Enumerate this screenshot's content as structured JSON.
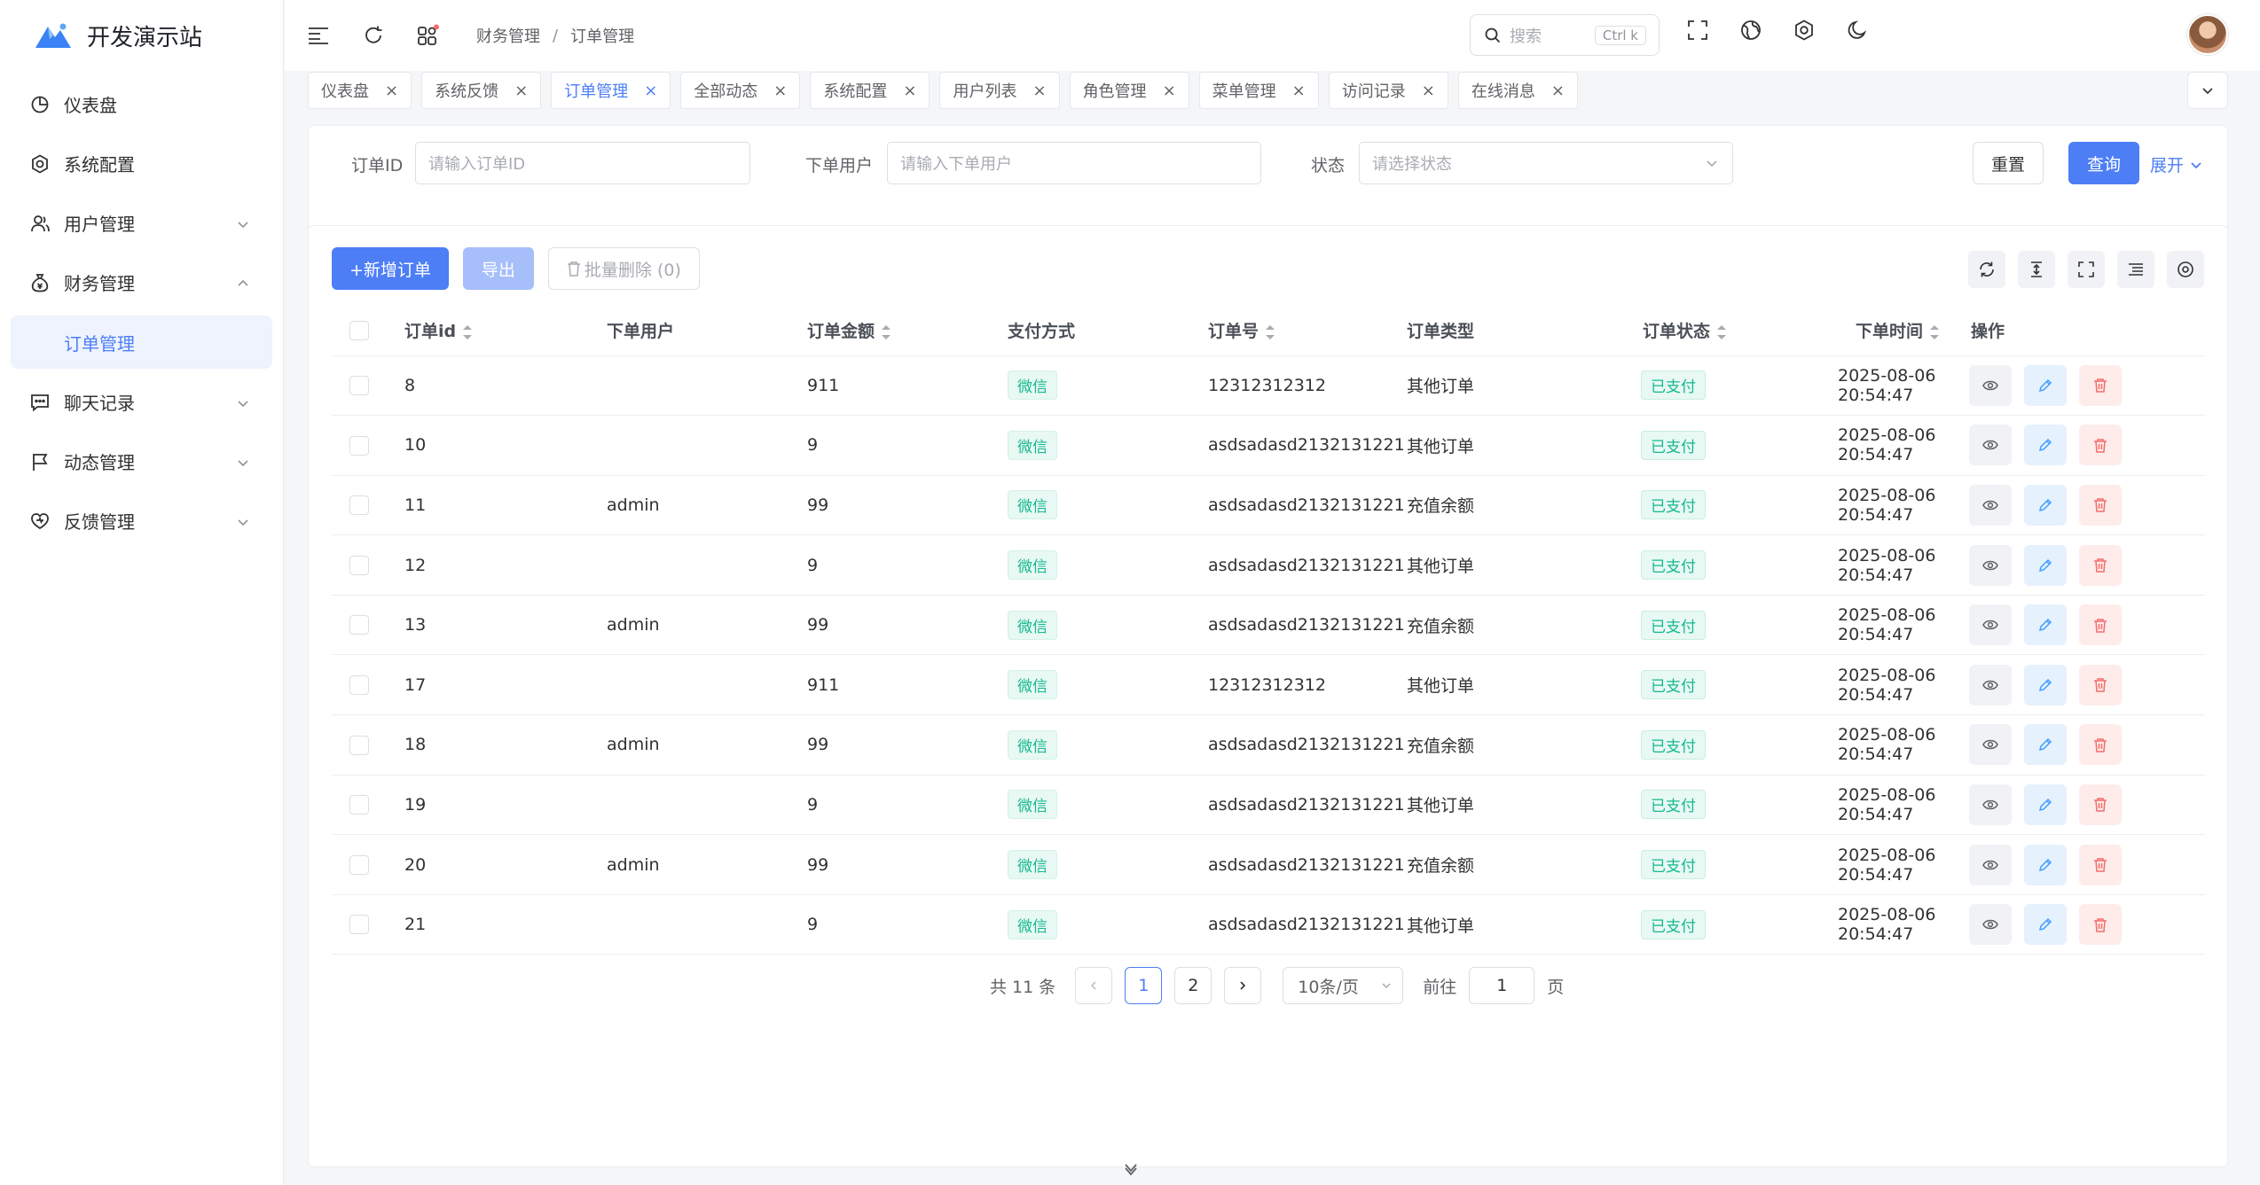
{
  "app": {
    "title": "开发演示站"
  },
  "sidebar": {
    "items": [
      {
        "label": "仪表盘",
        "icon": "dashboard-icon"
      },
      {
        "label": "系统配置",
        "icon": "gear-icon"
      },
      {
        "label": "用户管理",
        "icon": "users-icon"
      },
      {
        "label": "财务管理",
        "icon": "money-bag-icon",
        "expanded": true
      },
      {
        "label": "订单管理",
        "icon": "",
        "active": true
      },
      {
        "label": "聊天记录",
        "icon": "chat-icon"
      },
      {
        "label": "动态管理",
        "icon": "flag-icon"
      },
      {
        "label": "反馈管理",
        "icon": "heart-icon"
      }
    ]
  },
  "header": {
    "breadcrumb": [
      "财务管理",
      "订单管理"
    ],
    "breadcrumb_sep": "/",
    "search_placeholder": "搜索",
    "search_shortcut": "Ctrl k"
  },
  "tabs": [
    {
      "label": "仪表盘",
      "active": false
    },
    {
      "label": "系统反馈",
      "active": false
    },
    {
      "label": "订单管理",
      "active": true
    },
    {
      "label": "全部动态",
      "active": false
    },
    {
      "label": "系统配置",
      "active": false
    },
    {
      "label": "用户列表",
      "active": false
    },
    {
      "label": "角色管理",
      "active": false
    },
    {
      "label": "菜单管理",
      "active": false
    },
    {
      "label": "访问记录",
      "active": false
    },
    {
      "label": "在线消息",
      "active": false
    }
  ],
  "filter": {
    "order_id_label": "订单ID",
    "order_id_placeholder": "请输入订单ID",
    "user_label": "下单用户",
    "user_placeholder": "请输入下单用户",
    "status_label": "状态",
    "status_placeholder": "请选择状态",
    "reset": "重置",
    "query": "查询",
    "expand": "展开"
  },
  "toolbar": {
    "add": "+新增订单",
    "export": "导出",
    "batch_delete": "批量删除 (0)"
  },
  "table": {
    "columns": [
      "订单id",
      "下单用户",
      "订单金额",
      "支付方式",
      "订单号",
      "订单类型",
      "订单状态",
      "下单时间",
      "操作"
    ],
    "rows": [
      {
        "id": "8",
        "user": "",
        "amount": "911",
        "pay": "微信",
        "no": "12312312312",
        "type": "其他订单",
        "status": "已支付",
        "time": "2025-08-06 20:54:47"
      },
      {
        "id": "10",
        "user": "",
        "amount": "9",
        "pay": "微信",
        "no": "asdsadasd2132131221",
        "type": "其他订单",
        "status": "已支付",
        "time": "2025-08-06 20:54:47"
      },
      {
        "id": "11",
        "user": "admin",
        "amount": "99",
        "pay": "微信",
        "no": "asdsadasd2132131221",
        "type": "充值余额",
        "status": "已支付",
        "time": "2025-08-06 20:54:47"
      },
      {
        "id": "12",
        "user": "",
        "amount": "9",
        "pay": "微信",
        "no": "asdsadasd2132131221",
        "type": "其他订单",
        "status": "已支付",
        "time": "2025-08-06 20:54:47"
      },
      {
        "id": "13",
        "user": "admin",
        "amount": "99",
        "pay": "微信",
        "no": "asdsadasd2132131221",
        "type": "充值余额",
        "status": "已支付",
        "time": "2025-08-06 20:54:47"
      },
      {
        "id": "17",
        "user": "",
        "amount": "911",
        "pay": "微信",
        "no": "12312312312",
        "type": "其他订单",
        "status": "已支付",
        "time": "2025-08-06 20:54:47"
      },
      {
        "id": "18",
        "user": "admin",
        "amount": "99",
        "pay": "微信",
        "no": "asdsadasd2132131221",
        "type": "充值余额",
        "status": "已支付",
        "time": "2025-08-06 20:54:47"
      },
      {
        "id": "19",
        "user": "",
        "amount": "9",
        "pay": "微信",
        "no": "asdsadasd2132131221",
        "type": "其他订单",
        "status": "已支付",
        "time": "2025-08-06 20:54:47"
      },
      {
        "id": "20",
        "user": "admin",
        "amount": "99",
        "pay": "微信",
        "no": "asdsadasd2132131221",
        "type": "充值余额",
        "status": "已支付",
        "time": "2025-08-06 20:54:47"
      },
      {
        "id": "21",
        "user": "",
        "amount": "9",
        "pay": "微信",
        "no": "asdsadasd2132131221",
        "type": "其他订单",
        "status": "已支付",
        "time": "2025-08-06 20:54:47"
      }
    ]
  },
  "pagination": {
    "total": "共 11 条",
    "pages": [
      "1",
      "2"
    ],
    "current": "1",
    "page_size": "10条/页",
    "goto_label": "前往",
    "goto_value": "1",
    "goto_suffix": "页"
  },
  "colors": {
    "primary": "#4d7ef6",
    "success": "#14b88e",
    "danger": "#f56c6c"
  }
}
